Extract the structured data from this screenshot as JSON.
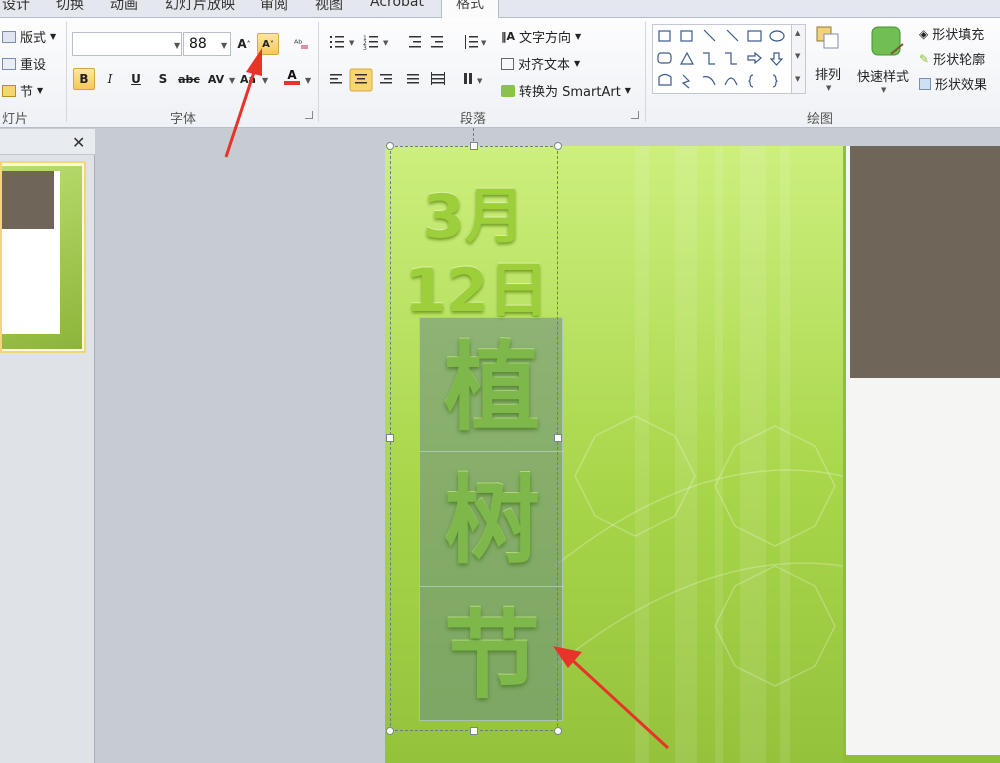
{
  "tabs": [
    "设计",
    "切换",
    "动画",
    "幻灯片放映",
    "审阅",
    "视图",
    "Acrobat",
    "格式"
  ],
  "active_tab": "格式",
  "slides_group": {
    "layout": "版式",
    "reset": "重设",
    "section": "节",
    "label": "灯片"
  },
  "font_group": {
    "font_name": "",
    "font_size": "88",
    "grow": "A",
    "shrink": "A",
    "bold": "B",
    "italic": "I",
    "underline": "U",
    "shadow": "S",
    "strike": "abc",
    "spacing": "AV",
    "case": "Aa",
    "color": "A",
    "label": "字体"
  },
  "paragraph_group": {
    "text_direction": "文字方向",
    "align_text": "对齐文本",
    "smartart": "转换为 SmartArt",
    "label": "段落"
  },
  "drawing_group": {
    "arrange": "排列",
    "quick_styles": "快速样式",
    "shape_fill": "形状填充",
    "shape_outline": "形状轮廓",
    "shape_effects": "形状效果",
    "label": "绘图"
  },
  "slide": {
    "date_month": "3月",
    "date_day": "12日",
    "char1": "植",
    "char2": "树",
    "char3": "节"
  },
  "colors": {
    "slide_green": "#a8d64a",
    "brown": "#6f6559",
    "arrow_red": "#e8332b",
    "font_color_red": "#e8332b"
  }
}
